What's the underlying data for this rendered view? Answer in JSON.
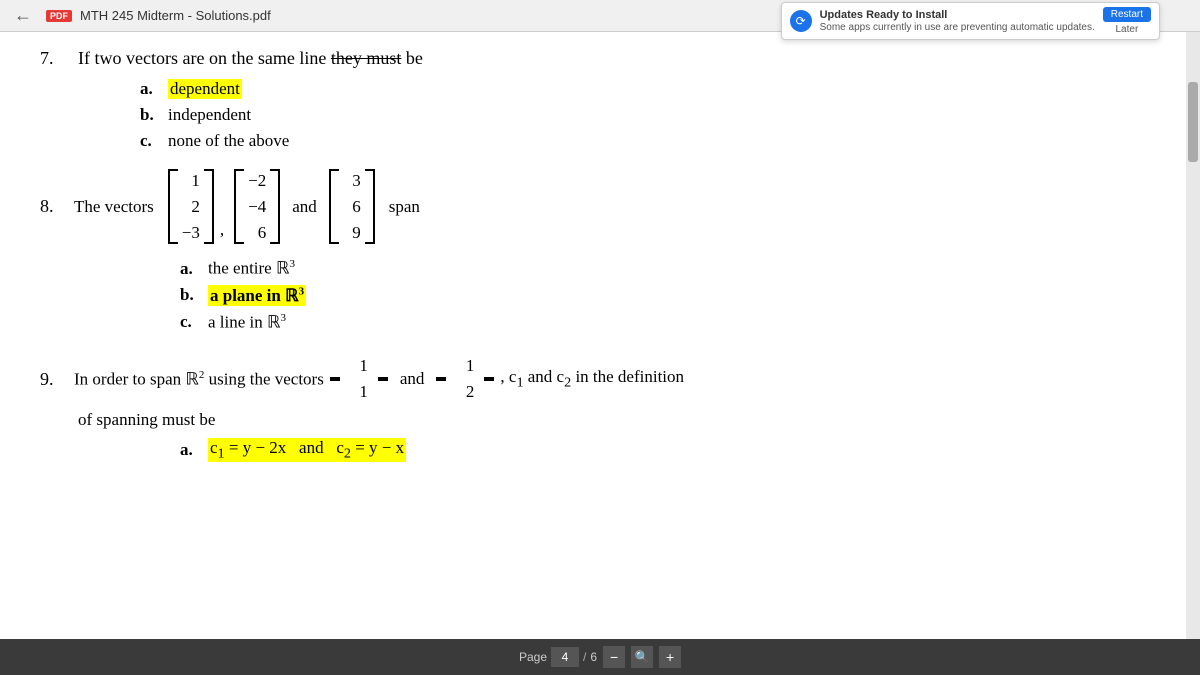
{
  "topbar": {
    "back_icon": "←",
    "pdf_badge": "PDF",
    "filename": "MTH 245 Midterm - Solutions.pdf"
  },
  "update_notification": {
    "title": "Updates Ready to Install",
    "subtitle": "Some apps currently in use are preventing automatic updates.",
    "restart_label": "Restart",
    "later_label": "Later"
  },
  "q7": {
    "number": "7.",
    "text_part1": "If two vectors are on the same line",
    "text_strikethrough": "they must",
    "text_part2": "be",
    "options": [
      {
        "letter": "a.",
        "text": "dependent",
        "highlighted": true
      },
      {
        "letter": "b.",
        "text": "independent",
        "highlighted": false
      },
      {
        "letter": "c.",
        "text": "none of the above",
        "highlighted": false
      }
    ]
  },
  "q8": {
    "number": "8.",
    "label": "The vectors",
    "matrix1": [
      "1",
      "2",
      "−3"
    ],
    "matrix2": [
      "−2",
      "−4",
      "6"
    ],
    "matrix3": [
      "3",
      "6",
      "9"
    ],
    "and_text": "and",
    "span_text": "span",
    "options": [
      {
        "letter": "a.",
        "text": "the entire ℝ³",
        "highlighted": false
      },
      {
        "letter": "b.",
        "text": "a plane in ℝ³",
        "highlighted": true
      },
      {
        "letter": "c.",
        "text": "a line in ℝ³",
        "highlighted": false
      }
    ]
  },
  "q9": {
    "number": "9.",
    "text_part1": "In order to span ℝ² using the vectors",
    "vector1": [
      "1",
      "1"
    ],
    "and_text": "and",
    "vector2": [
      "1",
      "2"
    ],
    "text_part2": ", c₁ and c₂ in the definition",
    "text_part3": "of spanning must be",
    "options": [
      {
        "letter": "a.",
        "text": "c₁ = y − 2x  and  c₂ = y − x",
        "highlighted": false
      }
    ]
  },
  "bottom_bar": {
    "page_label": "Page",
    "page_current": "4",
    "page_separator": "/",
    "page_total": "6",
    "zoom_minus": "−",
    "zoom_plus": "+"
  }
}
